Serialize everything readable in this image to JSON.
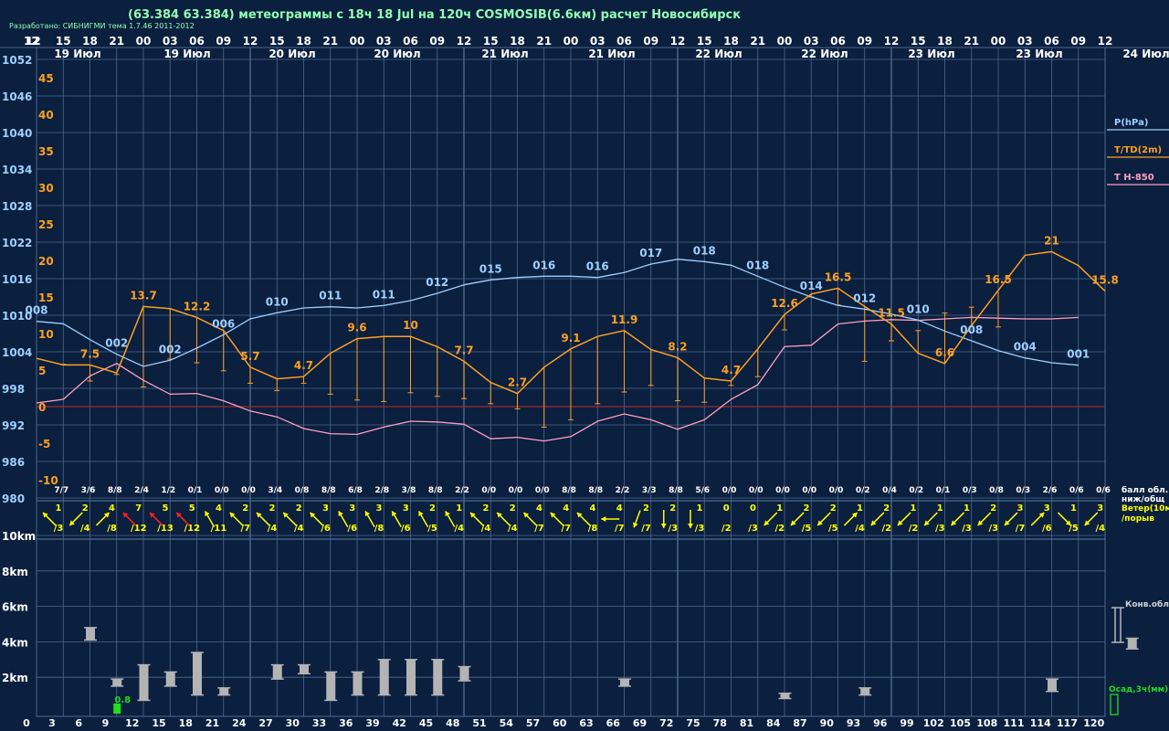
{
  "header": {
    "title": "(63.384 63.384) метеограммы с  18ч 18 Jul на 120ч COSMOSIB(6.6км) расчет Новосибирск",
    "credit": "Разработано: СИБНИГМИ тема 1.7.46 2011-2012"
  },
  "colors": {
    "background": "#0b1f3f",
    "grid": "#4d6a8e",
    "pressure": "#9fd0ff",
    "temperature": "#ffa020",
    "t850": "#ffa0c0",
    "zero_line": "#9a2a2a",
    "wind": "#ffff00",
    "wind_strong": "#ff2020",
    "cloud_bar": "#b4b4b4",
    "precip": "#20dd20",
    "title": "#90ffb0"
  },
  "chart_data": {
    "type": "line",
    "hour_labels": [
      "12",
      "15",
      "18",
      "21",
      "00",
      "03",
      "06",
      "09",
      "12",
      "15",
      "18",
      "21",
      "00",
      "03",
      "06",
      "09",
      "12",
      "15",
      "18",
      "21",
      "00",
      "03",
      "06",
      "09",
      "12",
      "15",
      "18",
      "21",
      "00",
      "03",
      "06",
      "09",
      "12",
      "15",
      "18",
      "21",
      "00",
      "03",
      "06",
      "09",
      "12"
    ],
    "date_labels": [
      "19 Июл",
      "19 Июл",
      "20 Июл",
      "20 Июл",
      "21 Июл",
      "21 Июл",
      "22 Июл",
      "22 Июл",
      "23 Июл",
      "23 Июл",
      "24 Июл"
    ],
    "forecast_hours": [
      "3",
      "6",
      "9",
      "12",
      "15",
      "18",
      "21",
      "24",
      "27",
      "30",
      "33",
      "36",
      "39",
      "42",
      "45",
      "48",
      "51",
      "54",
      "57",
      "60",
      "63",
      "66",
      "69",
      "72",
      "75",
      "78",
      "81",
      "84",
      "87",
      "90",
      "93",
      "96",
      "99",
      "102",
      "105",
      "108",
      "111",
      "114",
      "117",
      "120"
    ],
    "forecast_hours_zero": "0",
    "pressure_axis": {
      "label": "P(hPa)",
      "range": [
        980,
        1052
      ],
      "ticks": [
        "1052",
        "1046",
        "1040",
        "1034",
        "1028",
        "1022",
        "1016",
        "1010",
        "1004",
        "998",
        "992",
        "986",
        "980"
      ]
    },
    "temperature_axis": {
      "label": "T/TD(2m)",
      "range": [
        -10,
        45
      ],
      "ticks": [
        "45",
        "40",
        "35",
        "30",
        "25",
        "20",
        "15",
        "10",
        "5",
        "0",
        "-5",
        "-10"
      ]
    },
    "height_axis": {
      "ticks": [
        "10km",
        "8km",
        "6km",
        "4km",
        "2km"
      ]
    },
    "series": [
      {
        "name": "P(hPa)",
        "values": [
          1009.0,
          1008.6,
          1006.0,
          1003.6,
          1001.6,
          1002.6,
          1004.6,
          1006.8,
          1009.4,
          1010.4,
          1011.2,
          1011.4,
          1011.2,
          1011.6,
          1012.4,
          1013.6,
          1015.0,
          1015.8,
          1016.2,
          1016.4,
          1016.4,
          1016.2,
          1017.0,
          1018.4,
          1019.2,
          1018.8,
          1018.2,
          1016.4,
          1014.6,
          1013.0,
          1011.6,
          1011.0,
          1010.2,
          1009.2,
          1007.4,
          1005.8,
          1004.2,
          1003.0,
          1002.2,
          1001.8
        ]
      },
      {
        "name": "T/TD(2m)",
        "values": [
          6.6,
          5.7,
          5.7,
          4.6,
          13.7,
          13.4,
          12.2,
          10.4,
          5.4,
          3.8,
          4.1,
          7.3,
          9.3,
          9.6,
          9.6,
          8.2,
          6.2,
          3.3,
          1.8,
          5.4,
          7.9,
          9.6,
          10.4,
          7.8,
          6.7,
          3.9,
          3.5,
          7.9,
          12.6,
          15.4,
          16.2,
          13.7,
          11.3,
          7.3,
          5.9,
          11.1,
          15.9,
          20.7,
          21.2,
          19.3,
          15.8
        ]
      },
      {
        "name": "T H-850",
        "values": [
          0.5,
          1.0,
          4.2,
          5.9,
          3.6,
          1.7,
          1.8,
          0.8,
          -0.6,
          -1.4,
          -3.0,
          -3.7,
          -3.8,
          -2.8,
          -2.0,
          -2.1,
          -2.4,
          -4.4,
          -4.2,
          -4.7,
          -4.1,
          -2.0,
          -1.0,
          -1.8,
          -3.1,
          -1.8,
          1.0,
          3.0,
          8.2,
          8.4,
          11.3,
          11.7,
          11.9,
          11.8,
          12.0,
          12.2,
          12.1,
          12.0,
          12.0,
          12.2
        ]
      }
    ],
    "dewpoints": [
      5.8,
      3.5,
      4.4,
      2.7,
      6.5,
      6.0,
      4.9,
      3.2,
      2.2,
      3.2,
      1.7,
      0.9,
      0.7,
      1.9,
      1.4,
      1.1,
      0.4,
      -0.3,
      -2.8,
      -1.8,
      0.4,
      2.0,
      2.9,
      0.8,
      0.6,
      2.9,
      4.1,
      10.5,
      15.0,
      13.9,
      6.2,
      9.0,
      10.4,
      12.8,
      13.6,
      10.9
    ],
    "pressure_labels": [
      {
        "i": 0,
        "text": "008"
      },
      {
        "i": 3,
        "text": "002"
      },
      {
        "i": 5,
        "text": "002"
      },
      {
        "i": 7,
        "text": "006"
      },
      {
        "i": 9,
        "text": "010"
      },
      {
        "i": 11,
        "text": "011"
      },
      {
        "i": 13,
        "text": "011"
      },
      {
        "i": 15,
        "text": "012"
      },
      {
        "i": 17,
        "text": "015"
      },
      {
        "i": 19,
        "text": "016"
      },
      {
        "i": 21,
        "text": "016"
      },
      {
        "i": 23,
        "text": "017"
      },
      {
        "i": 25,
        "text": "018"
      },
      {
        "i": 27,
        "text": "018"
      },
      {
        "i": 29,
        "text": "014"
      },
      {
        "i": 31,
        "text": "012"
      },
      {
        "i": 33,
        "text": "010"
      },
      {
        "i": 35,
        "text": "008"
      },
      {
        "i": 37,
        "text": "004"
      },
      {
        "i": 39,
        "text": "001"
      }
    ],
    "temperature_labels": [
      {
        "i": 2,
        "text": "7.5"
      },
      {
        "i": 4,
        "text": "13.7"
      },
      {
        "i": 6,
        "text": "12.2"
      },
      {
        "i": 8,
        "text": "5.7"
      },
      {
        "i": 10,
        "text": "4.7"
      },
      {
        "i": 12,
        "text": "9.6"
      },
      {
        "i": 14,
        "text": "10"
      },
      {
        "i": 16,
        "text": "7.7"
      },
      {
        "i": 18,
        "text": "2.7"
      },
      {
        "i": 20,
        "text": "9.1"
      },
      {
        "i": 22,
        "text": "11.9"
      },
      {
        "i": 24,
        "text": "8.2"
      },
      {
        "i": 26,
        "text": "4.7"
      },
      {
        "i": 28,
        "text": "12.6"
      },
      {
        "i": 30,
        "text": "16.5"
      },
      {
        "i": 32,
        "text": "11.5"
      },
      {
        "i": 34,
        "text": "6.6"
      },
      {
        "i": 36,
        "text": "16.5"
      },
      {
        "i": 38,
        "text": "21"
      },
      {
        "i": 40,
        "text": "15.8"
      }
    ],
    "cloud_cover": [
      "7/7",
      "3/6",
      "8/8",
      "2/4",
      "1/2",
      "0/1",
      "0/0",
      "0/0",
      "3/4",
      "0/8",
      "8/8",
      "6/8",
      "2/8",
      "3/8",
      "8/8",
      "2/2",
      "0/0",
      "0/0",
      "0/0",
      "8/8",
      "8/8",
      "2/2",
      "3/3",
      "8/8",
      "5/6",
      "0/0",
      "0/0",
      "0/0",
      "0/0",
      "0/0",
      "0/2",
      "0/4",
      "0/2",
      "0/1",
      "0/3",
      "0/8",
      "0/3",
      "2/6",
      "0/6",
      "0/6"
    ],
    "wind": [
      {
        "speed": "1",
        "gust": "/3",
        "dir": 315
      },
      {
        "speed": "2",
        "gust": "/4",
        "dir": 225
      },
      {
        "speed": "4",
        "gust": "/8",
        "dir": 45
      },
      {
        "speed": "7",
        "gust": "/12",
        "dir": 315
      },
      {
        "speed": "5",
        "gust": "/13",
        "dir": 315
      },
      {
        "speed": "5",
        "gust": "/12",
        "dir": 315
      },
      {
        "speed": "4",
        "gust": "/11",
        "dir": 330
      },
      {
        "speed": "2",
        "gust": "/7",
        "dir": 315
      },
      {
        "speed": "2",
        "gust": "/4",
        "dir": 315
      },
      {
        "speed": "2",
        "gust": "/4",
        "dir": 315
      },
      {
        "speed": "3",
        "gust": "/6",
        "dir": 315
      },
      {
        "speed": "3",
        "gust": "/6",
        "dir": 330
      },
      {
        "speed": "3",
        "gust": "/8",
        "dir": 330
      },
      {
        "speed": "3",
        "gust": "/6",
        "dir": 330
      },
      {
        "speed": "2",
        "gust": "/5",
        "dir": 330
      },
      {
        "speed": "1",
        "gust": "/4",
        "dir": 330
      },
      {
        "speed": "2",
        "gust": "/4",
        "dir": 315
      },
      {
        "speed": "2",
        "gust": "/4",
        "dir": 315
      },
      {
        "speed": "4",
        "gust": "/7",
        "dir": 315
      },
      {
        "speed": "4",
        "gust": "/7",
        "dir": 315
      },
      {
        "speed": "4",
        "gust": "/8",
        "dir": 315
      },
      {
        "speed": "4",
        "gust": "/7",
        "dir": 270
      },
      {
        "speed": "2",
        "gust": "/7",
        "dir": 200
      },
      {
        "speed": "2",
        "gust": "/3",
        "dir": 180
      },
      {
        "speed": "1",
        "gust": "/3",
        "dir": 180
      },
      {
        "speed": "0",
        "gust": "/2",
        "dir": 0
      },
      {
        "speed": "0",
        "gust": "/3",
        "dir": 0
      },
      {
        "speed": "1",
        "gust": "/2",
        "dir": 225
      },
      {
        "speed": "2",
        "gust": "/5",
        "dir": 225
      },
      {
        "speed": "2",
        "gust": "/5",
        "dir": 225
      },
      {
        "speed": "1",
        "gust": "/4",
        "dir": 45
      },
      {
        "speed": "2",
        "gust": "/2",
        "dir": 225
      },
      {
        "speed": "1",
        "gust": "/2",
        "dir": 225
      },
      {
        "speed": "1",
        "gust": "/3",
        "dir": 225
      },
      {
        "speed": "1",
        "gust": "/3",
        "dir": 225
      },
      {
        "speed": "2",
        "gust": "/3",
        "dir": 225
      },
      {
        "speed": "3",
        "gust": "/7",
        "dir": 225
      },
      {
        "speed": "3",
        "gust": "/6",
        "dir": 45
      },
      {
        "speed": "1",
        "gust": "/5",
        "dir": 135
      },
      {
        "speed": "3",
        "gust": "/4",
        "dir": 225
      }
    ],
    "cloud_layers_km": [
      {
        "i": 2,
        "bottom": 4.1,
        "top": 4.8
      },
      {
        "i": 3,
        "bottom": 1.5,
        "top": 1.9
      },
      {
        "i": 4,
        "bottom": 0.7,
        "top": 2.7
      },
      {
        "i": 5,
        "bottom": 1.5,
        "top": 2.3
      },
      {
        "i": 6,
        "bottom": 1.0,
        "top": 3.4
      },
      {
        "i": 7,
        "bottom": 1.0,
        "top": 1.4
      },
      {
        "i": 9,
        "bottom": 1.9,
        "top": 2.7
      },
      {
        "i": 10,
        "bottom": 2.2,
        "top": 2.7
      },
      {
        "i": 11,
        "bottom": 0.7,
        "top": 2.3
      },
      {
        "i": 12,
        "bottom": 1.0,
        "top": 2.3
      },
      {
        "i": 13,
        "bottom": 1.0,
        "top": 3.0
      },
      {
        "i": 14,
        "bottom": 1.0,
        "top": 3.0
      },
      {
        "i": 15,
        "bottom": 1.0,
        "top": 3.0
      },
      {
        "i": 16,
        "bottom": 1.8,
        "top": 2.6
      },
      {
        "i": 22,
        "bottom": 1.5,
        "top": 1.9
      },
      {
        "i": 28,
        "bottom": 0.8,
        "top": 1.1
      },
      {
        "i": 31,
        "bottom": 1.0,
        "top": 1.4
      },
      {
        "i": 38,
        "bottom": 1.2,
        "top": 1.9
      },
      {
        "i": 41,
        "bottom": 3.6,
        "top": 4.2
      }
    ],
    "precip": [
      {
        "i": 3,
        "value": 0.8,
        "text": "0.8"
      }
    ],
    "legend": [
      "P(hPa)",
      "T/TD(2m)",
      "T H-850"
    ],
    "wind_legend": [
      "Ветер(10м)",
      "/порыв"
    ],
    "cloud_row_label": [
      "балл обл.",
      "ниж/общ"
    ],
    "convective_label": "Конв.обл.",
    "precip_label": "Осад,3ч(мм)"
  }
}
